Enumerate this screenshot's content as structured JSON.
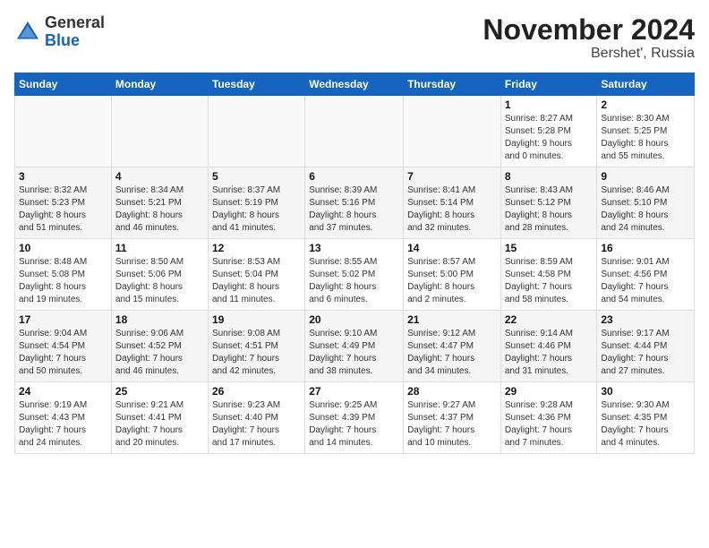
{
  "header": {
    "logo_general": "General",
    "logo_blue": "Blue",
    "month_title": "November 2024",
    "subtitle": "Bershet', Russia"
  },
  "days_of_week": [
    "Sunday",
    "Monday",
    "Tuesday",
    "Wednesday",
    "Thursday",
    "Friday",
    "Saturday"
  ],
  "weeks": [
    [
      {
        "day": "",
        "info": ""
      },
      {
        "day": "",
        "info": ""
      },
      {
        "day": "",
        "info": ""
      },
      {
        "day": "",
        "info": ""
      },
      {
        "day": "",
        "info": ""
      },
      {
        "day": "1",
        "info": "Sunrise: 8:27 AM\nSunset: 5:28 PM\nDaylight: 9 hours\nand 0 minutes."
      },
      {
        "day": "2",
        "info": "Sunrise: 8:30 AM\nSunset: 5:25 PM\nDaylight: 8 hours\nand 55 minutes."
      }
    ],
    [
      {
        "day": "3",
        "info": "Sunrise: 8:32 AM\nSunset: 5:23 PM\nDaylight: 8 hours\nand 51 minutes."
      },
      {
        "day": "4",
        "info": "Sunrise: 8:34 AM\nSunset: 5:21 PM\nDaylight: 8 hours\nand 46 minutes."
      },
      {
        "day": "5",
        "info": "Sunrise: 8:37 AM\nSunset: 5:19 PM\nDaylight: 8 hours\nand 41 minutes."
      },
      {
        "day": "6",
        "info": "Sunrise: 8:39 AM\nSunset: 5:16 PM\nDaylight: 8 hours\nand 37 minutes."
      },
      {
        "day": "7",
        "info": "Sunrise: 8:41 AM\nSunset: 5:14 PM\nDaylight: 8 hours\nand 32 minutes."
      },
      {
        "day": "8",
        "info": "Sunrise: 8:43 AM\nSunset: 5:12 PM\nDaylight: 8 hours\nand 28 minutes."
      },
      {
        "day": "9",
        "info": "Sunrise: 8:46 AM\nSunset: 5:10 PM\nDaylight: 8 hours\nand 24 minutes."
      }
    ],
    [
      {
        "day": "10",
        "info": "Sunrise: 8:48 AM\nSunset: 5:08 PM\nDaylight: 8 hours\nand 19 minutes."
      },
      {
        "day": "11",
        "info": "Sunrise: 8:50 AM\nSunset: 5:06 PM\nDaylight: 8 hours\nand 15 minutes."
      },
      {
        "day": "12",
        "info": "Sunrise: 8:53 AM\nSunset: 5:04 PM\nDaylight: 8 hours\nand 11 minutes."
      },
      {
        "day": "13",
        "info": "Sunrise: 8:55 AM\nSunset: 5:02 PM\nDaylight: 8 hours\nand 6 minutes."
      },
      {
        "day": "14",
        "info": "Sunrise: 8:57 AM\nSunset: 5:00 PM\nDaylight: 8 hours\nand 2 minutes."
      },
      {
        "day": "15",
        "info": "Sunrise: 8:59 AM\nSunset: 4:58 PM\nDaylight: 7 hours\nand 58 minutes."
      },
      {
        "day": "16",
        "info": "Sunrise: 9:01 AM\nSunset: 4:56 PM\nDaylight: 7 hours\nand 54 minutes."
      }
    ],
    [
      {
        "day": "17",
        "info": "Sunrise: 9:04 AM\nSunset: 4:54 PM\nDaylight: 7 hours\nand 50 minutes."
      },
      {
        "day": "18",
        "info": "Sunrise: 9:06 AM\nSunset: 4:52 PM\nDaylight: 7 hours\nand 46 minutes."
      },
      {
        "day": "19",
        "info": "Sunrise: 9:08 AM\nSunset: 4:51 PM\nDaylight: 7 hours\nand 42 minutes."
      },
      {
        "day": "20",
        "info": "Sunrise: 9:10 AM\nSunset: 4:49 PM\nDaylight: 7 hours\nand 38 minutes."
      },
      {
        "day": "21",
        "info": "Sunrise: 9:12 AM\nSunset: 4:47 PM\nDaylight: 7 hours\nand 34 minutes."
      },
      {
        "day": "22",
        "info": "Sunrise: 9:14 AM\nSunset: 4:46 PM\nDaylight: 7 hours\nand 31 minutes."
      },
      {
        "day": "23",
        "info": "Sunrise: 9:17 AM\nSunset: 4:44 PM\nDaylight: 7 hours\nand 27 minutes."
      }
    ],
    [
      {
        "day": "24",
        "info": "Sunrise: 9:19 AM\nSunset: 4:43 PM\nDaylight: 7 hours\nand 24 minutes."
      },
      {
        "day": "25",
        "info": "Sunrise: 9:21 AM\nSunset: 4:41 PM\nDaylight: 7 hours\nand 20 minutes."
      },
      {
        "day": "26",
        "info": "Sunrise: 9:23 AM\nSunset: 4:40 PM\nDaylight: 7 hours\nand 17 minutes."
      },
      {
        "day": "27",
        "info": "Sunrise: 9:25 AM\nSunset: 4:39 PM\nDaylight: 7 hours\nand 14 minutes."
      },
      {
        "day": "28",
        "info": "Sunrise: 9:27 AM\nSunset: 4:37 PM\nDaylight: 7 hours\nand 10 minutes."
      },
      {
        "day": "29",
        "info": "Sunrise: 9:28 AM\nSunset: 4:36 PM\nDaylight: 7 hours\nand 7 minutes."
      },
      {
        "day": "30",
        "info": "Sunrise: 9:30 AM\nSunset: 4:35 PM\nDaylight: 7 hours\nand 4 minutes."
      }
    ]
  ]
}
